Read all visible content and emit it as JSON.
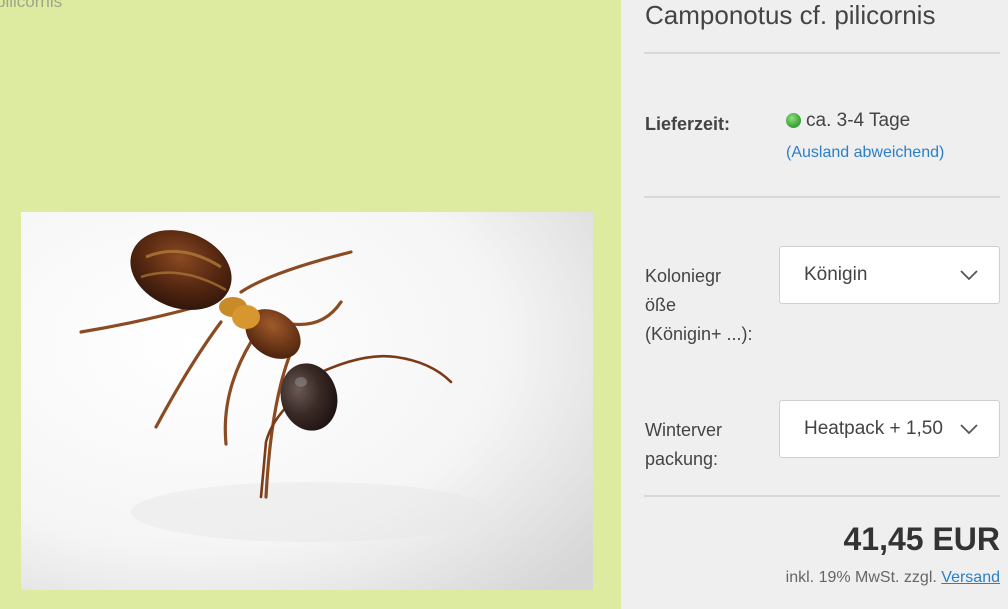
{
  "gallery": {
    "caption": "pilicornis",
    "image_alt": "Camponotus cf. pilicornis"
  },
  "product": {
    "title": "Camponotus cf. pilicornis"
  },
  "delivery": {
    "label": "Lieferzeit:",
    "status_color": "#3ea83a",
    "value": "ca. 3-4 Tage",
    "abroad_link": "(Ausland abweichend)"
  },
  "options": {
    "colony_size": {
      "label": "Koloniegr öße (Königin+ ...):",
      "selected": "Königin"
    },
    "winter_packaging": {
      "label": "Winterver packung:",
      "selected": "Heatpack + 1,50"
    }
  },
  "pricing": {
    "price": "41,45 EUR",
    "tax_note": "inkl. 19% MwSt. zzgl.",
    "shipping_link": "Versand"
  },
  "colors": {
    "gallery_bg": "#dceb9f",
    "panel_bg": "#efefef",
    "link": "#2b7fc7"
  }
}
